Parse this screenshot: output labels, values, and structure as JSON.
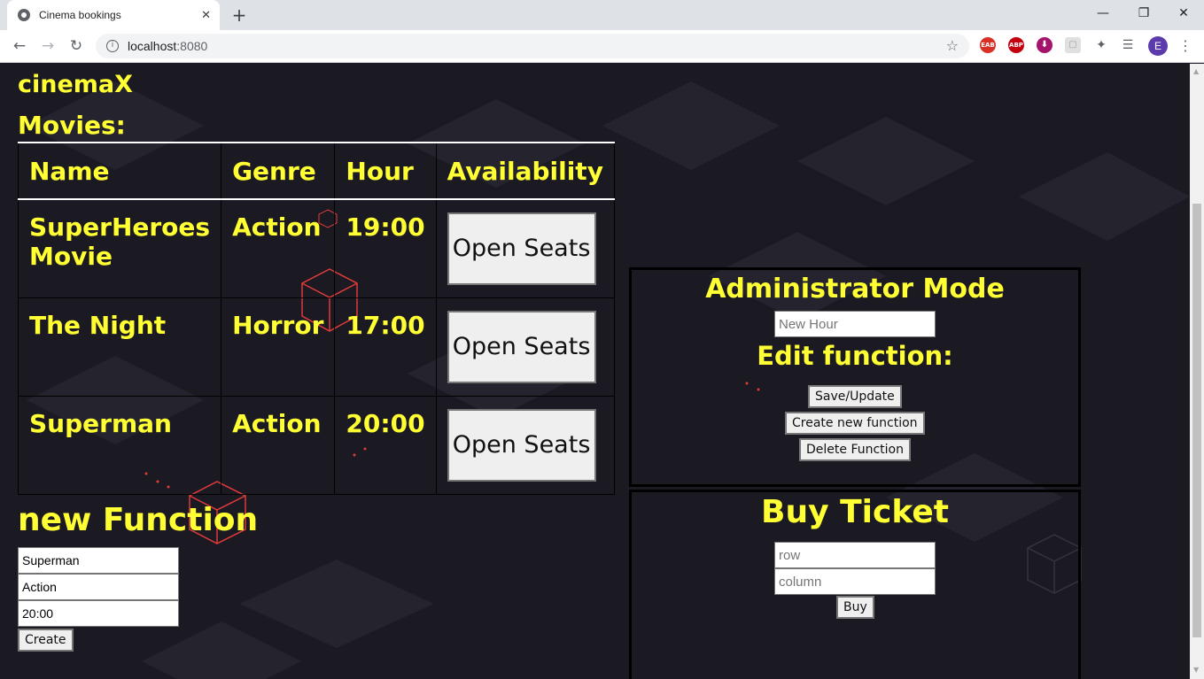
{
  "browser": {
    "tab_title": "Cinema bookings",
    "tab_close": "✕",
    "new_tab": "+",
    "url_host": "localhost",
    "url_port": ":8080",
    "window_controls": {
      "minimize": "—",
      "maximize": "❐",
      "close": "✕"
    },
    "nav": {
      "back": "←",
      "forward": "→",
      "reload": "↻"
    },
    "extensions": [
      "EAB",
      "ABP",
      "⬇",
      "▢",
      "✦",
      "☰"
    ],
    "avatar_letter": "E"
  },
  "page": {
    "brand": "cinemaX",
    "movies_heading": "Movies:",
    "table": {
      "headers": [
        "Name",
        "Genre",
        "Hour",
        "Availability"
      ],
      "rows": [
        {
          "name": "SuperHeroes Movie",
          "genre": "Action",
          "hour": "19:00",
          "button": "Open Seats"
        },
        {
          "name": "The Night",
          "genre": "Horror",
          "hour": "17:00",
          "button": "Open Seats"
        },
        {
          "name": "Superman",
          "genre": "Action",
          "hour": "20:00",
          "button": "Open Seats"
        }
      ]
    },
    "new_function": {
      "heading": "new Function",
      "name_value": "Superman",
      "genre_value": "Action",
      "hour_value": "20:00",
      "create_label": "Create"
    },
    "admin": {
      "title": "Administrator Mode",
      "new_hour_placeholder": "New Hour",
      "edit_title": "Edit function:",
      "save_label": "Save/Update",
      "create_label": "Create new function",
      "delete_label": "Delete Function"
    },
    "buy": {
      "title": "Buy Ticket",
      "row_placeholder": "row",
      "column_placeholder": "column",
      "buy_label": "Buy"
    }
  },
  "colors": {
    "accent_text": "#ffff33",
    "page_background": "#1b1a22",
    "decor_cube": "#e03a3a"
  }
}
